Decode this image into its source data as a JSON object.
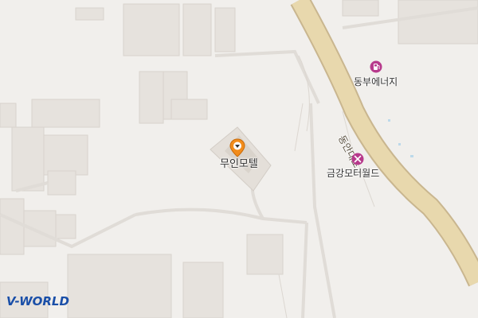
{
  "map": {
    "road_label": "동안대로",
    "places": [
      {
        "name": "무인모텔",
        "icon": "location-pin-icon",
        "color": "#f28c1b"
      },
      {
        "name": "동부에너지",
        "icon": "fuel-station-icon",
        "color": "#b73a8c"
      },
      {
        "name": "금강모터월드",
        "icon": "car-repair-icon",
        "color": "#b73a8c"
      }
    ],
    "logo": "V-WORLD"
  }
}
